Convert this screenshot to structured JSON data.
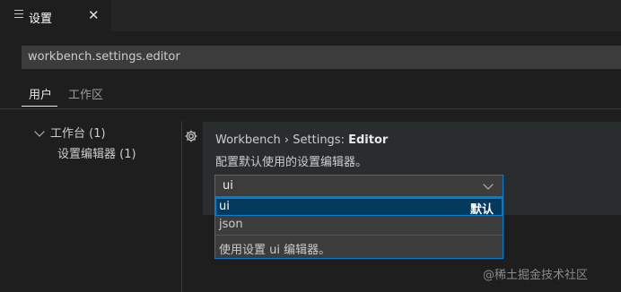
{
  "editor_tab": {
    "title": "设置",
    "icon": "list-icon",
    "close": "✕"
  },
  "search": {
    "value": "workbench.settings.editor"
  },
  "scope_tabs": [
    {
      "label": "用户"
    },
    {
      "label": "工作区"
    }
  ],
  "toc": {
    "group_label": "工作台 (1)",
    "item_label": "设置编辑器 (1)"
  },
  "setting": {
    "category": "Workbench › Settings: ",
    "name": "Editor",
    "description": "配置默认使用的设置编辑器。",
    "value": "ui",
    "options": [
      {
        "label": "ui",
        "badge": "默认"
      },
      {
        "label": "json"
      }
    ],
    "option_description": "使用设置 ui 编辑器。"
  },
  "watermark": "@稀土掘金技术社区",
  "colors": {
    "accent": "#007fd4",
    "selected_bg": "#04395e",
    "background": "#1e1e1e"
  }
}
